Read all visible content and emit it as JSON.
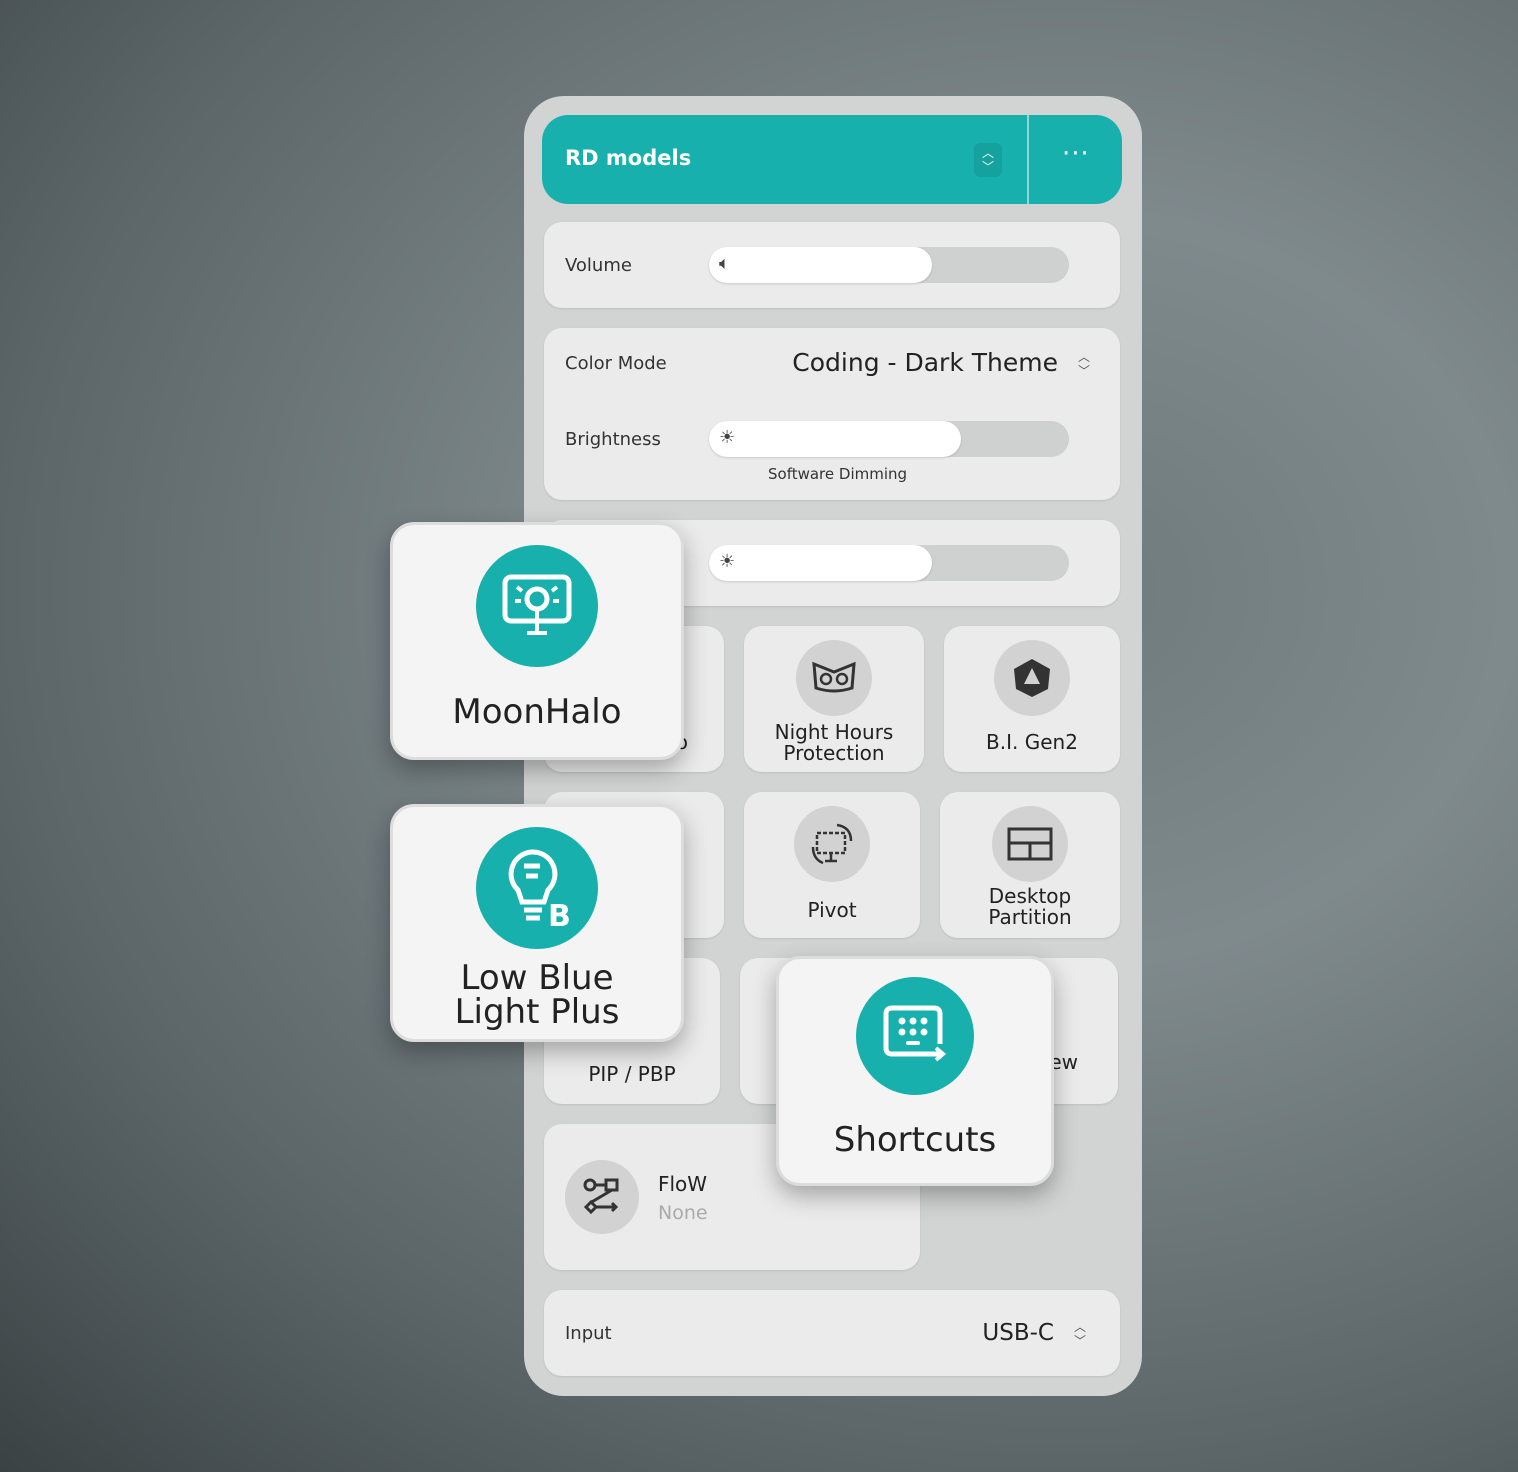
{
  "colors": {
    "accent": "#18b0ac",
    "panel": "#d2d4d4",
    "card": "#ebebeb"
  },
  "header": {
    "title": "RD models",
    "stepper_icon": "chevron-up-down-icon",
    "more_icon": "more-horizontal-icon",
    "more_label": "···"
  },
  "volume": {
    "label": "Volume",
    "icon": "speaker-icon",
    "level_percent": 62
  },
  "color_mode": {
    "label": "Color Mode",
    "value": "Coding - Dark Theme"
  },
  "brightness": {
    "label": "Brightness",
    "icon": "sun-icon",
    "level_percent": 70,
    "caption": "Software Dimming"
  },
  "third_slider": {
    "icon": "sun-icon",
    "level_percent": 62
  },
  "tiles": [
    {
      "label": "o",
      "icon": "hidden"
    },
    {
      "label": "Night Hours Protection",
      "icon": "owl-icon"
    },
    {
      "label": "B.I. Gen2",
      "icon": "bi-gen2-icon"
    },
    {
      "label": "",
      "icon": "hidden"
    },
    {
      "label": "Pivot",
      "icon": "pivot-icon"
    },
    {
      "label": "Desktop Partition",
      "icon": "partition-icon"
    },
    {
      "label": "PIP / PBP",
      "icon": "pip-icon"
    },
    {
      "label": "",
      "icon": "hidden"
    },
    {
      "label": "ew",
      "icon": "hidden"
    }
  ],
  "flow": {
    "title": "FloW",
    "value": "None",
    "icon": "flow-icon"
  },
  "input": {
    "label": "Input",
    "value": "USB-C"
  },
  "popups": [
    {
      "label": "MoonHalo",
      "icon": "monitor-halo-icon"
    },
    {
      "label": "Low Blue Light Plus",
      "icon": "bulb-icon"
    },
    {
      "label": "Shortcuts",
      "icon": "keyboard-shortcut-icon"
    }
  ]
}
